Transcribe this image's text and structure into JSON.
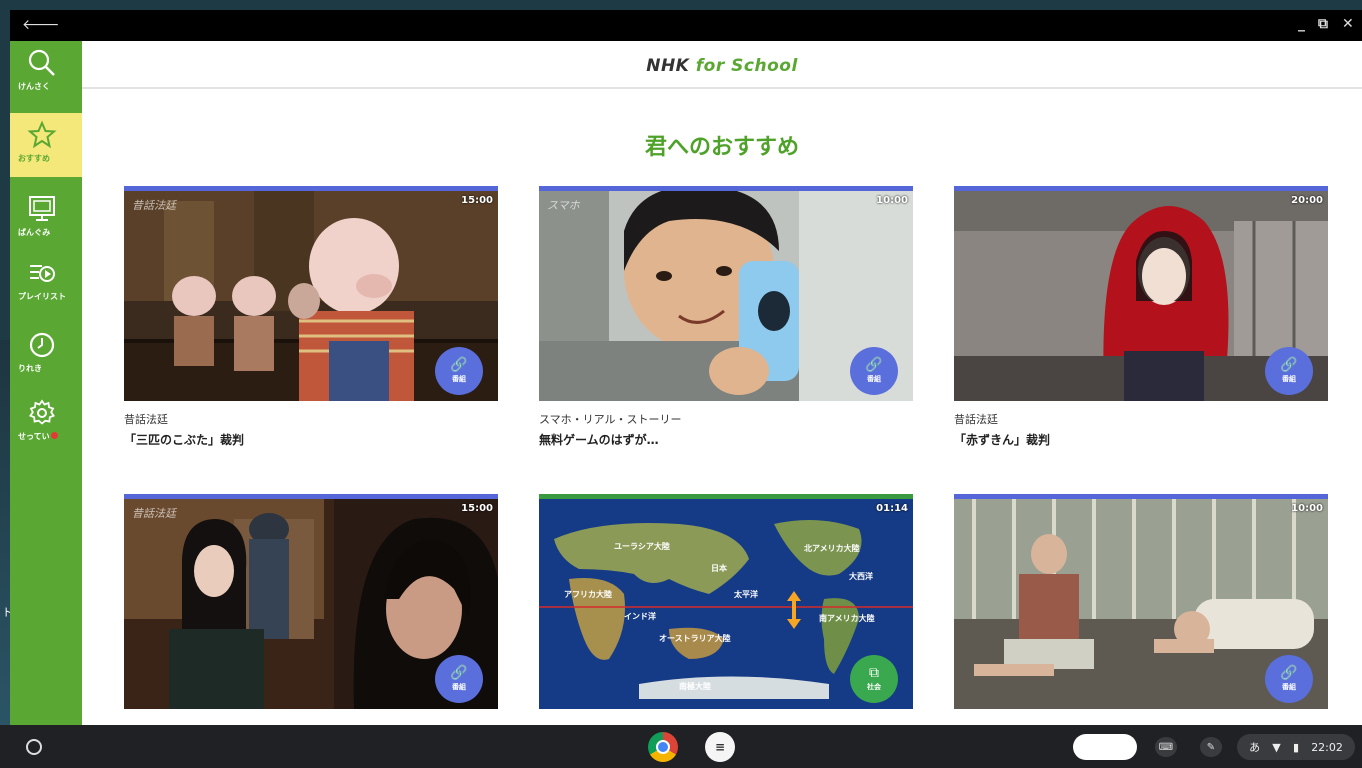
{
  "window": {
    "back_icon": "🡐",
    "minimize": "_",
    "restore": "⧉",
    "close": "✕"
  },
  "app": {
    "logo_main": "NHK",
    "logo_accent": "for School"
  },
  "sidebar": {
    "items": [
      {
        "icon": "search-icon",
        "label": "けんさく"
      },
      {
        "icon": "star-icon",
        "label": "おすすめ"
      },
      {
        "icon": "tv-icon",
        "label": "ばんぐみ"
      },
      {
        "icon": "playlist-icon",
        "label": "プレイリスト"
      },
      {
        "icon": "clock-icon",
        "label": "りれき"
      },
      {
        "icon": "gear-icon",
        "label": "せってい"
      }
    ]
  },
  "main": {
    "section_title": "君へのおすすめ",
    "cards": [
      {
        "duration": "15:00",
        "series": "昔話法廷",
        "title": "「三匹のこぶた」裁判",
        "badge": "番組"
      },
      {
        "duration": "10:00",
        "series": "スマホ・リアル・ストーリー",
        "title": "無料ゲームのはずが…",
        "badge": "番組"
      },
      {
        "duration": "20:00",
        "series": "昔話法廷",
        "title": "「赤ずきん」裁判",
        "badge": "番組"
      },
      {
        "duration": "15:00",
        "series": "",
        "title": "",
        "badge": "番組"
      },
      {
        "duration": "01:14",
        "series": "",
        "title": "",
        "badge": "社会"
      },
      {
        "duration": "10:00",
        "series": "",
        "title": "",
        "badge": "番組"
      }
    ],
    "map_labels": [
      "日本",
      "太平洋",
      "大西洋",
      "インド洋",
      "北アメリカ大陸",
      "南アメリカ大陸",
      "オーストラリア大陸",
      "南極大陸",
      "ユーラシア大陸",
      "アフリカ大陸"
    ]
  },
  "taskbar": {
    "app2_label": "≡",
    "ime": "あ",
    "time": "22:02"
  },
  "desktop": {
    "edge_text": "ト"
  }
}
